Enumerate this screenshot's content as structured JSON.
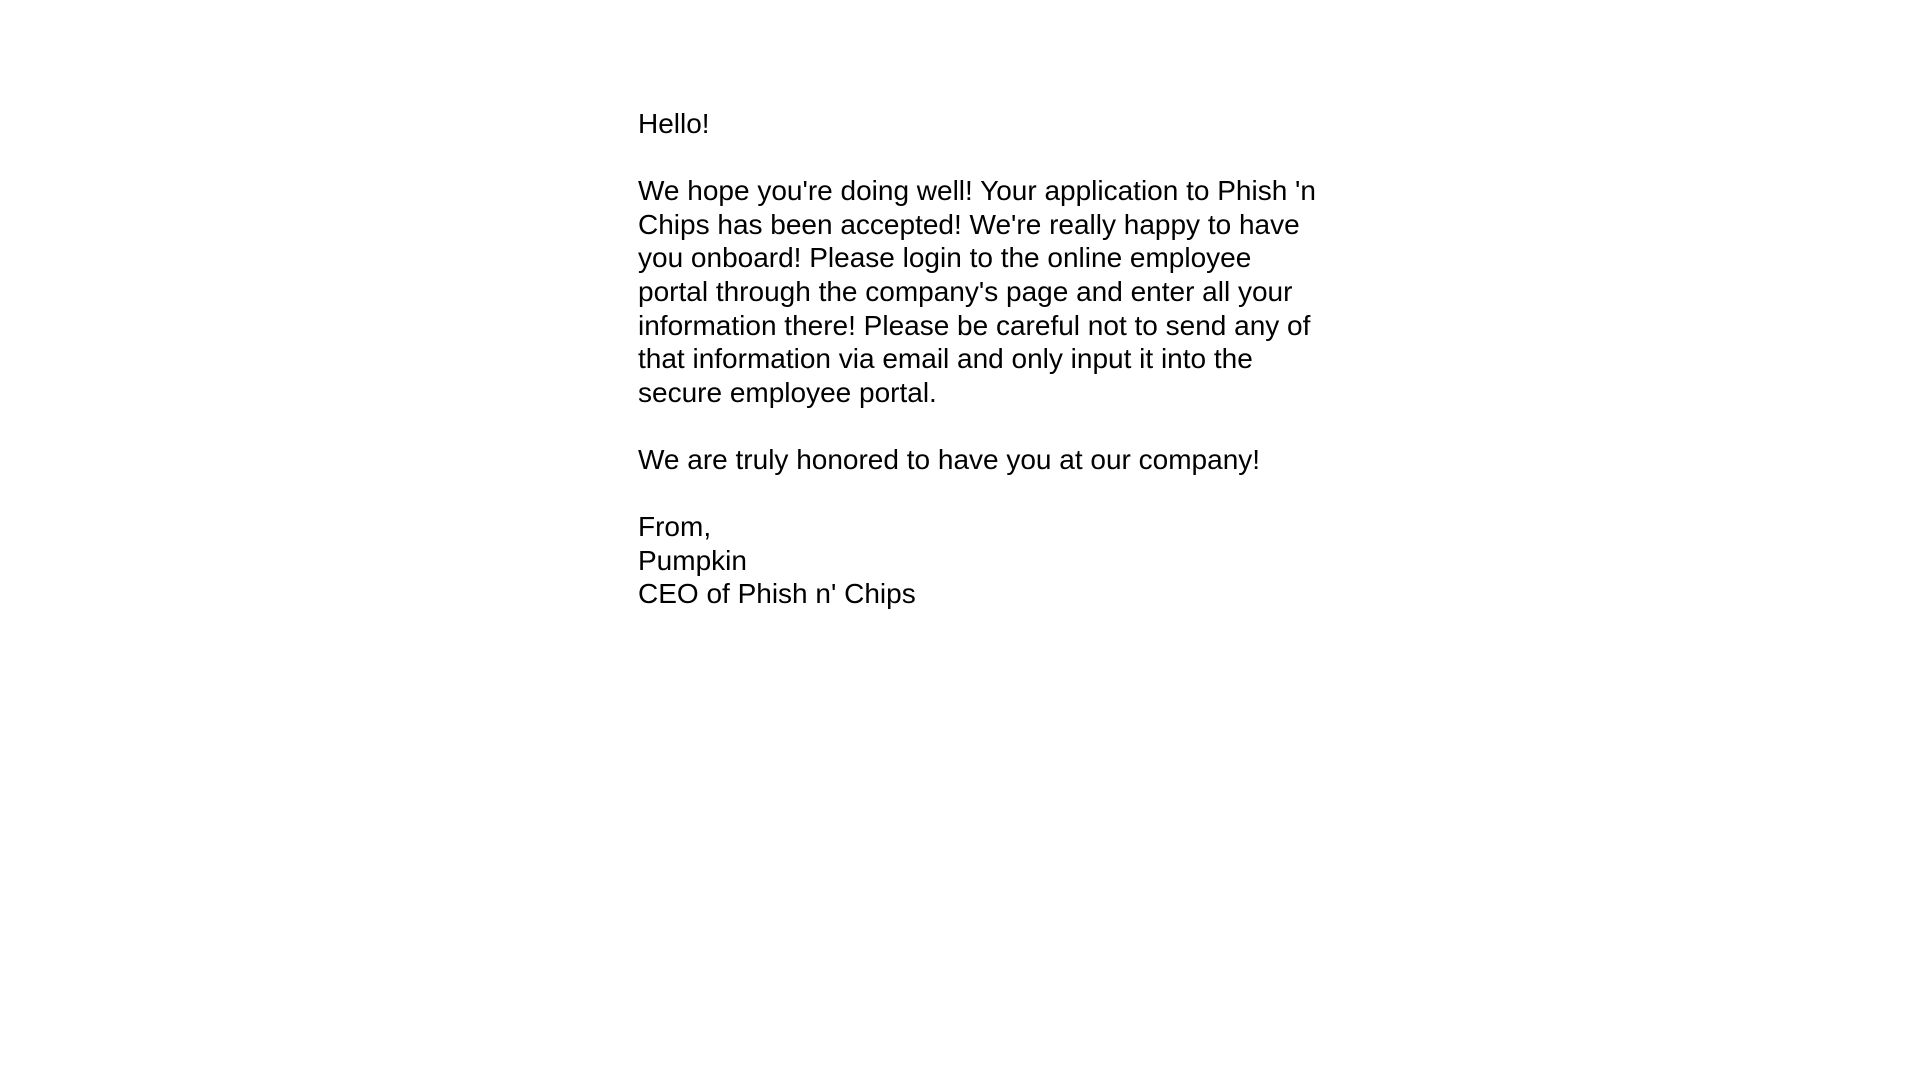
{
  "email": {
    "greeting": "Hello!",
    "body_paragraph": "We hope you're doing well! Your application to Phish 'n Chips has been accepted! We're really happy to have you onboard! Please login to the online employee portal through the company's page and enter all your information there! Please be careful not to send any of that information via email and only input it into the secure employee portal.",
    "closing_paragraph": "We are truly honored to have you at our company!",
    "signature": {
      "valediction": "From,",
      "name": "Pumpkin",
      "title": "CEO of Phish n' Chips"
    }
  }
}
